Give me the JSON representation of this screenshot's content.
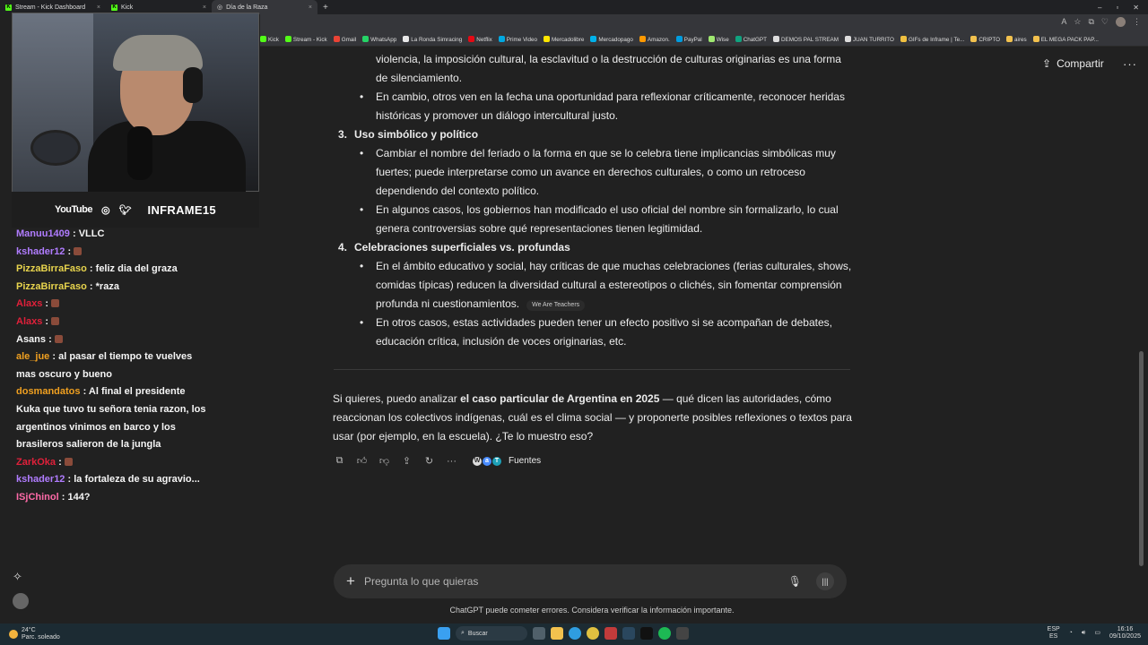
{
  "browser": {
    "tabs": [
      {
        "label": "Stream - Kick Dashboard",
        "active": false
      },
      {
        "label": "Kick",
        "active": false
      },
      {
        "label": "Día de la Raza",
        "active": true
      }
    ],
    "bookmarks": [
      "Kick",
      "Stream - Kick",
      "Gmail",
      "WhatsApp",
      "La Ronda Simracing",
      "Netflix",
      "Prime Video",
      "Mercadolibre",
      "Mercadopago",
      "Amazon.",
      "PayPal",
      "Wise",
      "ChatGPT",
      "DEMOS PAL STREAM",
      "JUAN TURRITO",
      "GIFs de Inframe | Te...",
      "CRIPTO",
      "aires",
      "EL MEGA PACK PAP..."
    ]
  },
  "header": {
    "share_label": "Compartir",
    "more_icon": "dots-horizontal-icon"
  },
  "content": {
    "top_para": "violencia, la imposición cultural, la esclavitud o la destrucción de culturas originarias es una forma de silenciamiento.",
    "top_bullet": "En cambio, otros ven en la fecha una oportunidad para reflexionar críticamente, reconocer heridas históricas y promover un diálogo intercultural justo.",
    "s3_num": "3.",
    "s3_title": "Uso simbólico y político",
    "s3_b1": "Cambiar el nombre del feriado o la forma en que se lo celebra tiene implicancias simbólicas muy fuertes; puede interpretarse como un avance en derechos culturales, o como un retroceso dependiendo del contexto político.",
    "s3_b2": "En algunos casos, los gobiernos han modificado el uso oficial del nombre sin formalizarlo, lo cual genera controversias sobre qué representaciones tienen legitimidad.",
    "s4_num": "4.",
    "s4_title": "Celebraciones superficiales vs. profundas",
    "s4_b1": "En el ámbito educativo y social, hay críticas de que muchas celebraciones (ferias culturales, shows, comidas típicas) reducen la diversidad cultural a estereotipos o clichés, sin fomentar comprensión profunda ni cuestionamientos.",
    "s4_b1_source": "We Are Teachers",
    "s4_b2": "En otros casos, estas actividades pueden tener un efecto positivo si se acompañan de debates, educación crítica, inclusión de voces originarias, etc.",
    "final_pre": "Si quieres, puedo analizar ",
    "final_bold": "el caso particular de Argentina en 2025",
    "final_post": " — qué dicen las autoridades, cómo reaccionan los colectivos indígenas, cuál es el clima social — y proponerte posibles reflexiones o textos para usar (por ejemplo, en la escuela). ¿Te lo muestro eso?"
  },
  "actions": {
    "sources_label": "Fuentes"
  },
  "composer": {
    "placeholder": "Pregunta lo que quieras",
    "disclaimer": "ChatGPT puede cometer errores. Considera verificar la información importante."
  },
  "overlay": {
    "social": {
      "youtube": "YouTube",
      "handle": "INFRAME15"
    },
    "chat": [
      {
        "user": "Manuu1409",
        "color": "#b07cff",
        "text": "VLLC"
      },
      {
        "user": "kshader12",
        "color": "#b07cff",
        "text": ""
      },
      {
        "user": "PizzaBirraFaso",
        "color": "#e8d44d",
        "text": "feliz dia del graza"
      },
      {
        "user": "PizzaBirraFaso",
        "color": "#e8d44d",
        "text": "*raza"
      },
      {
        "user": "Alaxs",
        "color": "#e0203a",
        "text": ""
      },
      {
        "user": "Alaxs",
        "color": "#e0203a",
        "text": ""
      },
      {
        "user": "Asans",
        "color": "#f5f5f5",
        "text": ""
      },
      {
        "user": "ale_jue",
        "color": "#f0a020",
        "text": "al pasar el tiempo te vuelves mas oscuro y bueno"
      },
      {
        "user": "dosmandatos",
        "color": "#f0a020",
        "text": "Al final el presidente Kuka que tuvo tu señora tenia razon, los argentinos vinimos en barco y los brasileros salieron de la jungla"
      },
      {
        "user": "ZarkOka",
        "color": "#e0203a",
        "text": ""
      },
      {
        "user": "kshader12",
        "color": "#b07cff",
        "text": "la fortaleza de su agravio..."
      },
      {
        "user": "ISjChinol",
        "color": "#ff6aa8",
        "text": "144?"
      }
    ]
  },
  "taskbar": {
    "temperature": "24°C",
    "weather": "Parc. soleado",
    "search": "Buscar",
    "lang": "ESP",
    "lang_sub": "ES",
    "time": "16:16",
    "date": "09/10/2025"
  }
}
